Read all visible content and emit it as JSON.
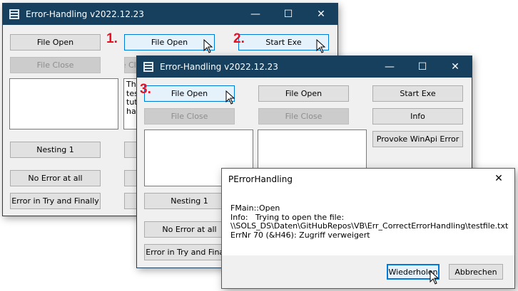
{
  "window1": {
    "title": "Error-Handling v2022.12.23",
    "buttons": {
      "file_open_left": "File Open",
      "file_open_center": "File Open",
      "start_exe": "Start Exe",
      "file_close_left": "File Close",
      "file_close_center": "File Close",
      "nesting": "Nesting 1",
      "no_error": "No Error at all",
      "error_try_finally": "Error in Try and Finally"
    },
    "textbox_lines": [
      "This",
      "test",
      "tuto",
      "han"
    ]
  },
  "window2": {
    "title": "Error-Handling v2022.12.23",
    "buttons": {
      "file_open_1": "File Open",
      "file_open_2": "File Open",
      "start_exe": "Start Exe",
      "file_close_1": "File Close",
      "file_close_2": "File Close",
      "info": "Info",
      "provoke": "Provoke WinApi Error",
      "nesting": "Nesting 1",
      "no_error": "No Error at all",
      "error_try_finally": "Error in Try and Finally"
    }
  },
  "dialog": {
    "title": "PErrorHandling",
    "lines": [
      "FMain::Open",
      "Info:   Trying to open the file:",
      "\\\\SOLS_DS\\Daten\\GitHubRepos\\VB\\Err_CorrectErrorHandling\\testfile.txt",
      "ErrNr 70 (&H46): Zugriff verweigert"
    ],
    "retry_label": "Wiederholen",
    "cancel_label": "Abbrechen"
  },
  "steps": [
    "1.",
    "2.",
    "3."
  ],
  "caption_glyphs": {
    "minimize": "—",
    "maximize": "☐",
    "close": "✕"
  }
}
